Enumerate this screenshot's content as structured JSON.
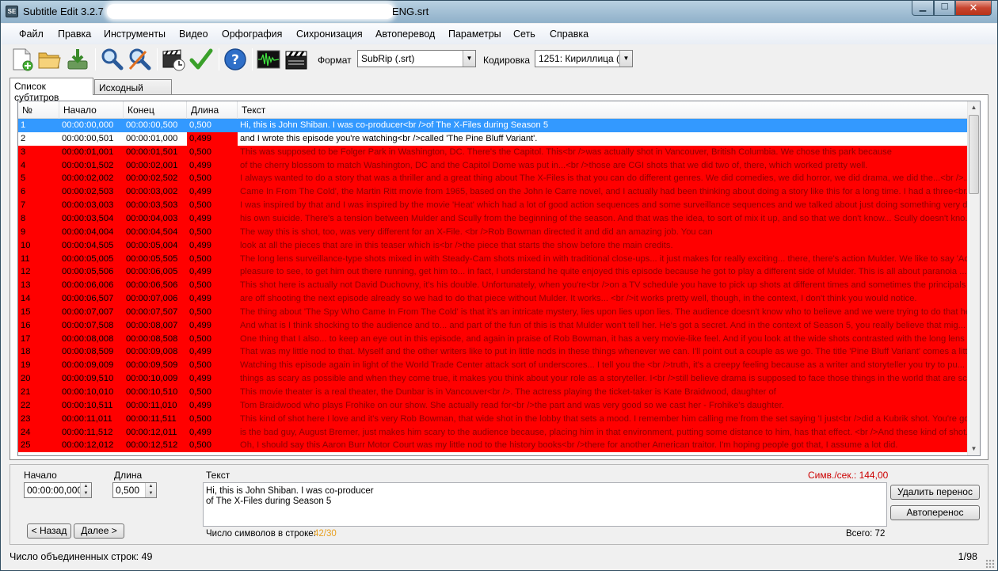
{
  "window": {
    "title_prefix": "Subtitle Edit 3.2.7 -",
    "title_suffix": "ENG.srt",
    "minimize": "▁",
    "maximize": "☐",
    "close": "✕",
    "app_icon_text": "SE"
  },
  "menu": [
    "Файл",
    "Правка",
    "Инструменты",
    "Видео",
    "Орфография",
    "Сихронизация",
    "Автоперевод",
    "Параметры",
    "Сеть",
    "Справка"
  ],
  "toolbar": {
    "icons": [
      "new-file-icon",
      "open-folder-icon",
      "save-icon",
      "find-icon",
      "replace-icon",
      "visual-sync-icon",
      "spell-check-icon",
      "help-icon",
      "waveform-icon",
      "video-clapper-icon"
    ],
    "format_label": "Формат",
    "format_value": "SubRip (.srt)",
    "encoding_label": "Кодировка",
    "encoding_value": "1251: Кириллица ("
  },
  "tabs": {
    "subtitle_list": "Список субтитров",
    "source_list": "Исходный список"
  },
  "table": {
    "headers": {
      "num": "№",
      "start": "Начало",
      "end": "Конец",
      "duration": "Длина",
      "text": "Текст"
    },
    "rows": [
      {
        "num": "1",
        "start": "00:00:00,000",
        "end": "00:00:00,500",
        "duration": "0,500",
        "text": "Hi, this is John Shiban. I was co-producer<br />of The X-Files during Season 5"
      },
      {
        "num": "2",
        "start": "00:00:00,501",
        "end": "00:00:01,000",
        "duration": "0,499",
        "text": "and I wrote this episode you're watching<br />called 'The Pine Bluff Variant'."
      },
      {
        "num": "3",
        "start": "00:00:01,001",
        "end": "00:00:01,501",
        "duration": "0,500",
        "text": "This was supposed to be Folger Park in Washington, DC. There's the Capitol. This<br />was actually shot in Vancouver, British Columbia. We chose this park because"
      },
      {
        "num": "4",
        "start": "00:00:01,502",
        "end": "00:00:02,001",
        "duration": "0,499",
        "text": "of the cherry blossom to match Washington, DC and the Capitol Dome was put in...<br />those are CGI shots that we did two of, there, which worked pretty well."
      },
      {
        "num": "5",
        "start": "00:00:02,002",
        "end": "00:00:02,502",
        "duration": "0,500",
        "text": "I always wanted to do a story that was a thriller and a great thing about The X-Files is that you can do different genres. We did comedies, we did horror, we did drama, we did the...<br />..."
      },
      {
        "num": "6",
        "start": "00:00:02,503",
        "end": "00:00:03,002",
        "duration": "0,499",
        "text": "Came In From The Cold', the Martin Ritt movie from 1965, based on the John le Carre novel, and I actually had been thinking about doing a story like this for a long time. I had a three<br..."
      },
      {
        "num": "7",
        "start": "00:00:03,003",
        "end": "00:00:03,503",
        "duration": "0,500",
        "text": "I was inspired by that and I was inspired by the movie 'Heat' which had a lot of good action sequences and some surveillance sequences and we talked about just doing something very diff..."
      },
      {
        "num": "8",
        "start": "00:00:03,504",
        "end": "00:00:04,003",
        "duration": "0,499",
        "text": "his own suicide. There's a tension between Mulder and Scully from the beginning of the season. And that was the idea, to sort of mix it up, and so that we don't know... Scully doesn't kno..."
      },
      {
        "num": "9",
        "start": "00:00:04,004",
        "end": "00:00:04,504",
        "duration": "0,500",
        "text": "The way this is shot, too, was very different for an X-File. <br />Rob Bowman directed it and did an amazing job. You can"
      },
      {
        "num": "10",
        "start": "00:00:04,505",
        "end": "00:00:05,004",
        "duration": "0,499",
        "text": "look at all the pieces that are in this teaser which is<br />the piece that starts the show before the main credits."
      },
      {
        "num": "11",
        "start": "00:00:05,005",
        "end": "00:00:05,505",
        "duration": "0,500",
        "text": "The long lens surveillance-type shots mixed in with Steady-Cam shots mixed in with traditional close-ups... it just makes for really exciting... there, there's action Mulder. We like to say 'Ac..."
      },
      {
        "num": "12",
        "start": "00:00:05,506",
        "end": "00:00:06,005",
        "duration": "0,499",
        "text": "pleasure to see, to get him out there running, get him to... in fact, I understand he quite enjoyed this episode because he got to play a different side of Mulder. This is all about paranoia ..."
      },
      {
        "num": "13",
        "start": "00:00:06,006",
        "end": "00:00:06,506",
        "duration": "0,500",
        "text": "This shot here is actually not David Duchovny, it's his double. Unfortunately, when you're<br />on a TV schedule you have to pick up shots at different times and sometimes the principals"
      },
      {
        "num": "14",
        "start": "00:00:06,507",
        "end": "00:00:07,006",
        "duration": "0,499",
        "text": "are off shooting the next episode already so we had to do that piece without Mulder. It works... <br />it works pretty well, though, in the context, I don't think you would notice."
      },
      {
        "num": "15",
        "start": "00:00:07,007",
        "end": "00:00:07,507",
        "duration": "0,500",
        "text": "The thing about 'The Spy Who Came In From The Cold' is that it's an intricate mystery, lies upon lies upon lies. The audience doesn't know who to believe and we were trying to do that her..."
      },
      {
        "num": "16",
        "start": "00:00:07,508",
        "end": "00:00:08,007",
        "duration": "0,499",
        "text": "And what is I think shocking to the audience and to... and part of the fun of this is that Mulder won't tell her. He's got a secret. And in the context of Season 5, you really believe that mig..."
      },
      {
        "num": "17",
        "start": "00:00:08,008",
        "end": "00:00:08,508",
        "duration": "0,500",
        "text": "One thing that I also... to keep an eye out in this episode, and again in praise of Rob Bowman, it has a very movie-like feel. And if you look at the wide shots contrasted with the long lens ..."
      },
      {
        "num": "18",
        "start": "00:00:08,509",
        "end": "00:00:09,008",
        "duration": "0,499",
        "text": "That was my little nod to that. Myself and the other writers like to put in little nods in these things whenever we can. I'll point out a couple as we go. The title 'Pine Bluff Variant' comes a litt..."
      },
      {
        "num": "19",
        "start": "00:00:09,009",
        "end": "00:00:09,509",
        "duration": "0,500",
        "text": "Watching this episode again in light of the World Trade Center attack sort of underscores... I tell you the <br />truth, it's a creepy feeling because as a writer and storyteller you try to pu..."
      },
      {
        "num": "20",
        "start": "00:00:09,510",
        "end": "00:00:10,009",
        "duration": "0,499",
        "text": "things as scary as possible and when they come true, it makes you think about your role as a storyteller. I<br />still believe drama is supposed to face those things in the world that are sc..."
      },
      {
        "num": "21",
        "start": "00:00:10,010",
        "end": "00:00:10,510",
        "duration": "0,500",
        "text": "This movie theater is a real theater, the Dunbar is in Vancouver<br />. The actress playing the ticket-taker is Kate Braidwood, daughter of"
      },
      {
        "num": "22",
        "start": "00:00:10,511",
        "end": "00:00:11,010",
        "duration": "0,499",
        "text": "Tom Braidwood who plays Frohike on our show. She actually read for<br />the part and was very good so we cast her - Frohike's daughter."
      },
      {
        "num": "23",
        "start": "00:00:11,011",
        "end": "00:00:11,511",
        "duration": "0,500",
        "text": "This kind of shot here I love and it's very Rob Bowman, that wide shot in the lobby that sets a mood. I remember him calling me from the set saying 'I just<br />did a Kubrik shot. You're go..."
      },
      {
        "num": "24",
        "start": "00:00:11,512",
        "end": "00:00:12,011",
        "duration": "0,499",
        "text": "is the bad guy, August Bremer, just makes him scary to the audience because, placing him in that environment, putting some distance to him, has that effect. <br />And these kind of shot..."
      },
      {
        "num": "25",
        "start": "00:00:12,012",
        "end": "00:00:12,512",
        "duration": "0,500",
        "text": "Oh, I should say this Aaron Burr Motor Court was my little nod to the history books<br />there for another American traitor. I'm hoping people got that, I assume a lot did."
      }
    ]
  },
  "editor": {
    "start_label": "Начало",
    "start_value": "00:00:00,000",
    "duration_label": "Длина",
    "duration_value": "0,500",
    "text_label": "Текст",
    "chars_per_sec": "Симв./сек.: 144,00",
    "text_line1": "Hi, this is John Shiban. I was co-producer",
    "text_line2": "of The X-Files during Season 5",
    "line_chars_label": "Число символов в строке:",
    "line_chars_value": "42/30",
    "total_label": "Всего: 72",
    "prev_button": "< Назад",
    "next_button": "Далее >",
    "remove_break_button": "Удалить перенос",
    "auto_break_button": "Автоперенос",
    "colors": {
      "error": "#ff0000",
      "warning_text": "#cc0000",
      "selection": "#3399ff",
      "chars_value": "#e8a020"
    }
  },
  "status": {
    "left": "Число объединенных строк: 49",
    "right": "1/98"
  }
}
